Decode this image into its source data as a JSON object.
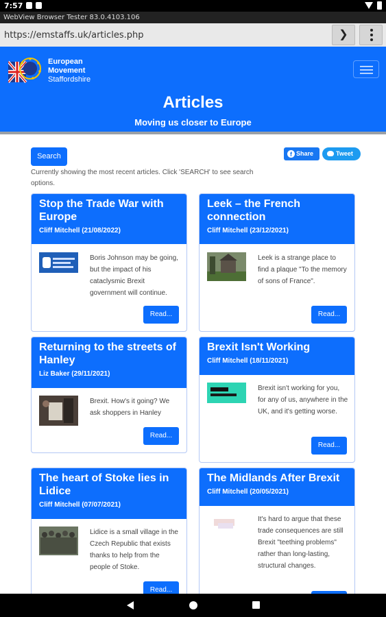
{
  "status": {
    "time": "7:57"
  },
  "app": {
    "title": "WebView Browser Tester 83.0.4103.106"
  },
  "browser": {
    "url": "https://emstaffs.uk/articles.php",
    "go_label": "❯"
  },
  "site": {
    "brand_line1": "European",
    "brand_line2": "Movement",
    "brand_line3": "Staffordshire",
    "page_title": "Articles",
    "tagline": "Moving us closer to Europe"
  },
  "toolbar": {
    "search_label": "Search",
    "share_label": "Share",
    "tweet_label": "Tweet",
    "intro": "Currently showing the most recent articles. Click 'SEARCH' to see search options."
  },
  "articles": [
    {
      "title": "Stop the Trade War with Europe",
      "meta": "Cliff Mitchell (21/08/2022)",
      "excerpt": "Boris Johnson may be going, but the impact of his cataclysmic Brexit government will continue.",
      "read_label": "Read..."
    },
    {
      "title": "Leek – the French connection",
      "meta": "Cliff Mitchell (23/12/2021)",
      "excerpt": "Leek is a strange place to find a plaque \"To the memory of sons of France\".",
      "read_label": "Read..."
    },
    {
      "title": "Returning to the streets of Hanley",
      "meta": "Liz Baker (29/11/2021)",
      "excerpt": "Brexit. How's it going? We ask shoppers in Hanley",
      "read_label": "Read..."
    },
    {
      "title": "Brexit Isn't Working",
      "meta": "Cliff Mitchell (18/11/2021)",
      "excerpt": "Brexit isn't working for you, for any of us, anywhere in the UK, and it's getting worse.",
      "read_label": "Read..."
    },
    {
      "title": "The heart of Stoke lies in Lidice",
      "meta": "Cliff Mitchell (07/07/2021)",
      "excerpt": "Lidice is a small village in the Czech Republic that exists thanks to help from the people of Stoke.",
      "read_label": "Read..."
    },
    {
      "title": "The Midlands After Brexit",
      "meta": "Cliff Mitchell (20/05/2021)",
      "excerpt": "It's hard to argue that these trade consequences are still Brexit \"teething problems\" rather than long-lasting, structural changes.",
      "read_label": "Read..."
    }
  ],
  "colors": {
    "brand_blue": "#0d6efd",
    "facebook": "#1877f2",
    "twitter": "#1d9bf0"
  }
}
